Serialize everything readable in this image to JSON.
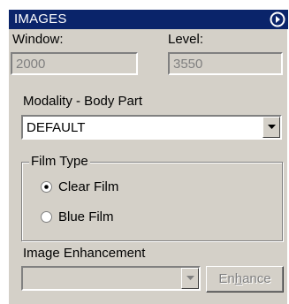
{
  "panel": {
    "title": "IMAGES",
    "collapse_icon": "collapse-arrow-icon"
  },
  "window": {
    "label": "Window:",
    "value": "2000"
  },
  "level": {
    "label": "Level:",
    "value": "3550"
  },
  "modality": {
    "label": "Modality - Body Part",
    "value": "DEFAULT"
  },
  "film_type": {
    "label": "Film Type",
    "options": [
      {
        "label": "Clear Film",
        "selected": true
      },
      {
        "label": "Blue Film",
        "selected": false
      }
    ]
  },
  "enhancement": {
    "label": "Image Enhancement",
    "value": "",
    "button_label_pre": "En",
    "button_label_ul": "h",
    "button_label_post": "ance"
  },
  "colors": {
    "titlebar": "#0a246a",
    "face": "#d4d0c8"
  }
}
